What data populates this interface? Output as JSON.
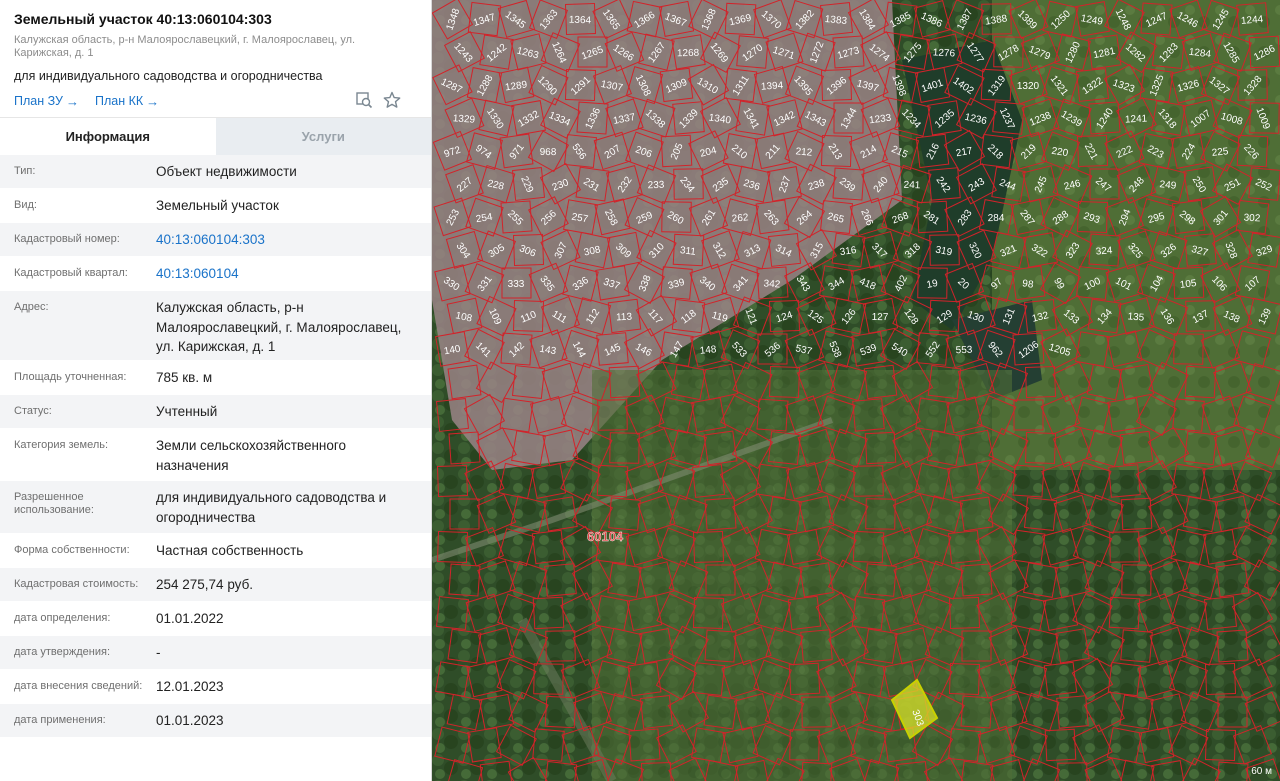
{
  "header": {
    "title": "Земельный участок 40:13:060104:303",
    "address": "Калужская область, р-н Малоярославецкий, г. Малоярославец, ул. Карижская, д. 1",
    "purpose": "для индивидуального садоводства и огородничества",
    "plan_zu": "План ЗУ",
    "plan_kk": "План КК",
    "icons": [
      "search-map-icon",
      "star-icon"
    ]
  },
  "tabs": [
    {
      "label": "Информация",
      "active": true
    },
    {
      "label": "Услуги",
      "active": false
    }
  ],
  "info": [
    {
      "label": "Тип:",
      "value": "Объект недвижимости"
    },
    {
      "label": "Вид:",
      "value": "Земельный участок"
    },
    {
      "label": "Кадастровый номер:",
      "value": "40:13:060104:303",
      "link": true
    },
    {
      "label": "Кадастровый квартал:",
      "value": "40:13:060104",
      "link": true
    },
    {
      "label": "Адрес:",
      "value": "Калужская область, р-н Малоярославецкий, г. Малоярославец, ул. Карижская, д. 1"
    },
    {
      "label": "Площадь уточненная:",
      "value": "785 кв. м"
    },
    {
      "label": "Статус:",
      "value": "Учтенный"
    },
    {
      "label": "Категория земель:",
      "value": "Земли сельскохозяйственного назначения"
    },
    {
      "label": "Разрешенное использование:",
      "value": "для индивидуального садоводства и огородничества"
    },
    {
      "label": "Форма собственности:",
      "value": "Частная собственность"
    },
    {
      "label": "Кадастровая стоимость:",
      "value": "254 275,74 руб."
    },
    {
      "label": "дата определения:",
      "value": "01.01.2022"
    },
    {
      "label": "дата утверждения:",
      "value": "-"
    },
    {
      "label": "дата внесения сведений:",
      "value": "12.01.2023"
    },
    {
      "label": "дата применения:",
      "value": "01.01.2023"
    }
  ],
  "map": {
    "quarter_label": "60104",
    "highlight_label": "303",
    "scale": "60 м",
    "plot_labels": [
      "1348",
      "1347",
      "1345",
      "1363",
      "1364",
      "1365",
      "1366",
      "1367",
      "1368",
      "1369",
      "1370",
      "1382",
      "1383",
      "1384",
      "1385",
      "1386",
      "1387",
      "1388",
      "1389",
      "1250",
      "1249",
      "1248",
      "1247",
      "1246",
      "1245",
      "1244",
      "1243",
      "1242",
      "1263",
      "1264",
      "1265",
      "1266",
      "1267",
      "1268",
      "1269",
      "1270",
      "1271",
      "1272",
      "1273",
      "1274",
      "1275",
      "1276",
      "1277",
      "1278",
      "1279",
      "1280",
      "1281",
      "1282",
      "1283",
      "1284",
      "1285",
      "1286",
      "1287",
      "1288",
      "1289",
      "1290",
      "1291",
      "1307",
      "1308",
      "1309",
      "1310",
      "1311",
      "1394",
      "1395",
      "1396",
      "1397",
      "1398",
      "1401",
      "1402",
      "1319",
      "1320",
      "1321",
      "1322",
      "1323",
      "1325",
      "1326",
      "1327",
      "1328",
      "1329",
      "1330",
      "1332",
      "1334",
      "1336",
      "1337",
      "1338",
      "1339",
      "1340",
      "1341",
      "1342",
      "1343",
      "1344",
      "1233",
      "1234",
      "1235",
      "1236",
      "1237",
      "1238",
      "1239",
      "1240",
      "1241",
      "1318",
      "1007",
      "1008",
      "1009",
      "972",
      "974",
      "971",
      "968",
      "556",
      "207",
      "206",
      "205",
      "204",
      "210",
      "211",
      "212",
      "213",
      "214",
      "215",
      "216",
      "217",
      "218",
      "219",
      "220",
      "221",
      "222",
      "223",
      "224",
      "225",
      "226",
      "227",
      "228",
      "229",
      "230",
      "231",
      "232",
      "233",
      "234",
      "235",
      "236",
      "237",
      "238",
      "239",
      "240",
      "241",
      "242",
      "243",
      "244",
      "245",
      "246",
      "247",
      "248",
      "249",
      "250",
      "251",
      "252",
      "253",
      "254",
      "255",
      "256",
      "257",
      "258",
      "259",
      "260",
      "261",
      "262",
      "263",
      "264",
      "265",
      "266",
      "268",
      "281",
      "283",
      "284",
      "287",
      "288",
      "293",
      "294",
      "295",
      "298",
      "301",
      "302",
      "304",
      "305",
      "306",
      "307",
      "308",
      "309",
      "310",
      "311",
      "312",
      "313",
      "314",
      "315",
      "316",
      "317",
      "318",
      "319",
      "320",
      "321",
      "322",
      "323",
      "324",
      "325",
      "326",
      "327",
      "328",
      "329",
      "330",
      "331",
      "333",
      "335",
      "336",
      "337",
      "338",
      "339",
      "340",
      "341",
      "342",
      "343",
      "344",
      "418",
      "402",
      "19",
      "20",
      "97",
      "98",
      "99",
      "100",
      "101",
      "104",
      "105",
      "106",
      "107",
      "108",
      "109",
      "110",
      "111",
      "112",
      "113",
      "117",
      "118",
      "119",
      "121",
      "124",
      "125",
      "126",
      "127",
      "128",
      "129",
      "130",
      "131",
      "132",
      "133",
      "134",
      "135",
      "136",
      "137",
      "138",
      "139",
      "140",
      "141",
      "142",
      "143",
      "144",
      "145",
      "146",
      "147",
      "148",
      "533",
      "536",
      "537",
      "538",
      "539",
      "540",
      "552",
      "553",
      "962",
      "1206",
      "1205"
    ]
  }
}
